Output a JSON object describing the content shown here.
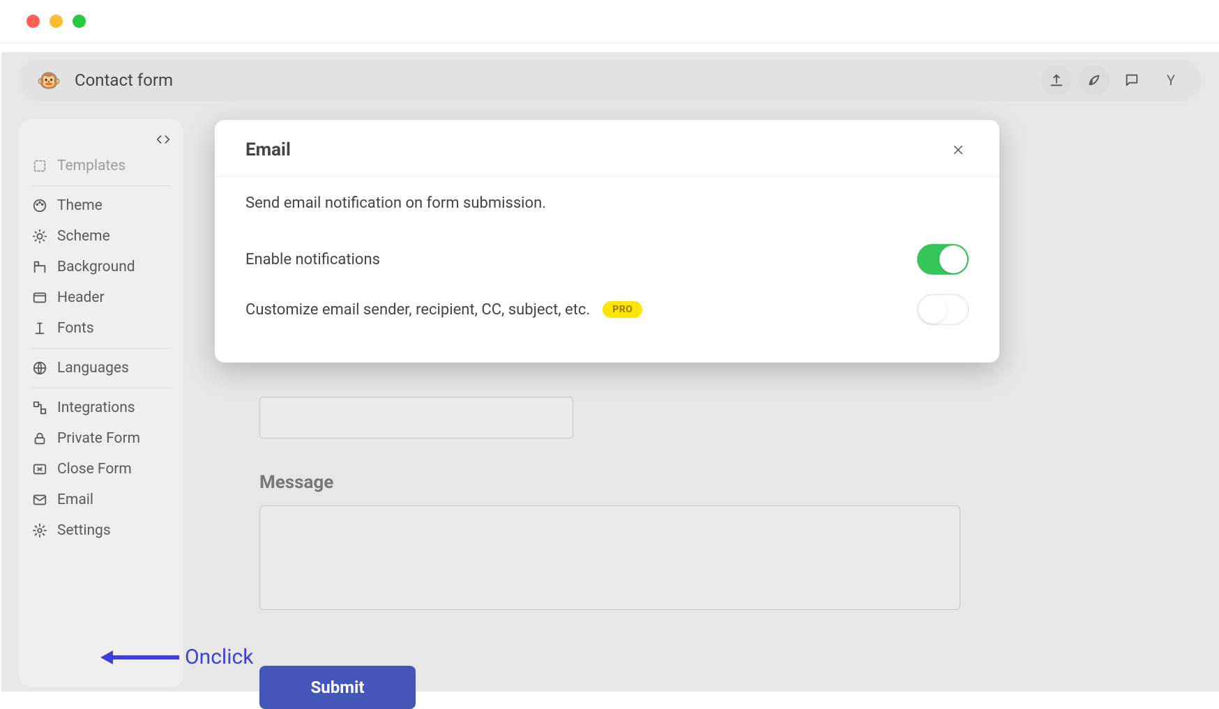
{
  "window": {
    "title": "Contact form",
    "avatar_letter": "Y"
  },
  "sidebar": {
    "items": [
      {
        "label": "Templates"
      },
      {
        "label": "Theme"
      },
      {
        "label": "Scheme"
      },
      {
        "label": "Background"
      },
      {
        "label": "Header"
      },
      {
        "label": "Fonts"
      },
      {
        "label": "Languages"
      },
      {
        "label": "Integrations"
      },
      {
        "label": "Private Form"
      },
      {
        "label": "Close Form"
      },
      {
        "label": "Email"
      },
      {
        "label": "Settings"
      }
    ]
  },
  "form": {
    "message_label": "Message",
    "submit_label": "Submit"
  },
  "dialog": {
    "title": "Email",
    "description": "Send email notification on form submission.",
    "row1_label": "Enable notifications",
    "row2_label": "Customize email sender, recipient, CC, subject, etc.",
    "pro_badge": "PRO",
    "enable_notifications": true,
    "customize_enabled": false
  },
  "annotation": {
    "text": "Onclick"
  }
}
